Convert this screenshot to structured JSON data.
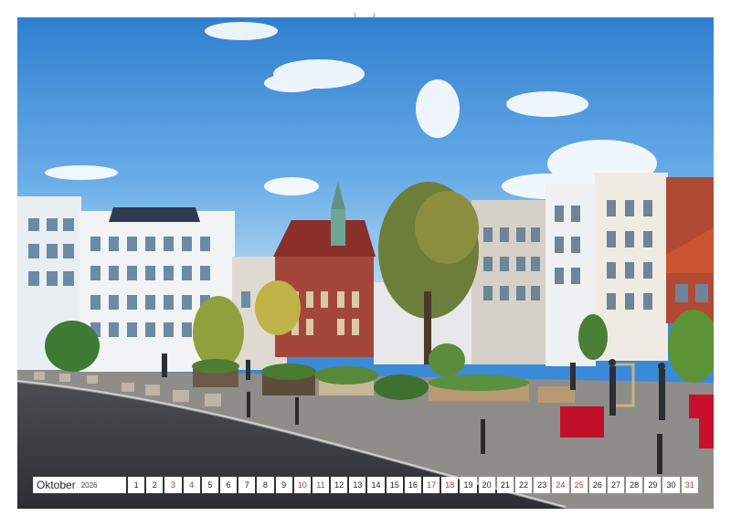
{
  "calendar": {
    "month": "Oktober",
    "year": "2026",
    "days": [
      "1",
      "2",
      "3",
      "4",
      "5",
      "6",
      "7",
      "8",
      "9",
      "10",
      "11",
      "12",
      "13",
      "14",
      "15",
      "16",
      "17",
      "18",
      "19",
      "20",
      "21",
      "22",
      "23",
      "24",
      "25",
      "26",
      "27",
      "28",
      "29",
      "30",
      "31"
    ],
    "weekend_days": [
      3,
      4,
      10,
      11,
      17,
      18,
      24,
      25,
      31
    ]
  },
  "photo": {
    "subject": "town-square-with-historic-buildings"
  },
  "colors": {
    "sky": "#3d8fd8",
    "weekend_text": "#c0392b",
    "table_cover": "#c0102a"
  }
}
